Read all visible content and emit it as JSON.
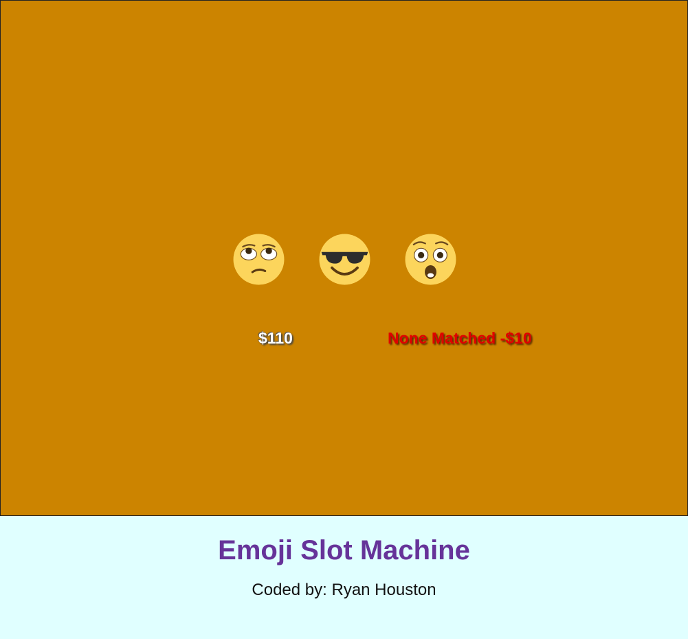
{
  "machine": {
    "background_color": "#cc8400",
    "reels": [
      {
        "icon": "eye-roll-emoji-icon"
      },
      {
        "icon": "sunglasses-emoji-icon"
      },
      {
        "icon": "astonished-emoji-icon"
      }
    ],
    "balance": "$110",
    "result_text": "None Matched -$10",
    "result_color": "#e00000"
  },
  "footer": {
    "title": "Emoji Slot Machine",
    "credit": "Coded by: Ryan Houston",
    "title_color": "#663399"
  }
}
